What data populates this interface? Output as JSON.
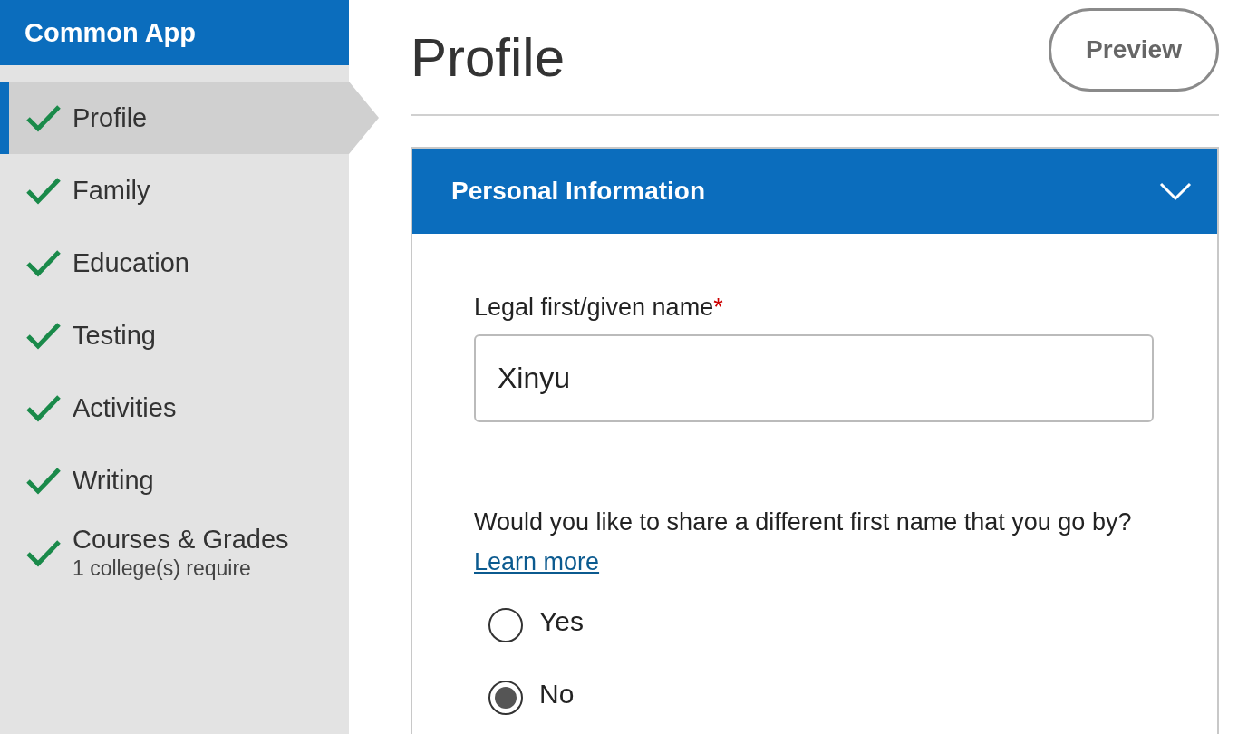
{
  "app_title": "Common App",
  "sidebar": {
    "items": [
      {
        "label": "Profile",
        "complete": true,
        "selected": true
      },
      {
        "label": "Family",
        "complete": true,
        "selected": false
      },
      {
        "label": "Education",
        "complete": true,
        "selected": false
      },
      {
        "label": "Testing",
        "complete": true,
        "selected": false
      },
      {
        "label": "Activities",
        "complete": true,
        "selected": false
      },
      {
        "label": "Writing",
        "complete": true,
        "selected": false
      },
      {
        "label": "Courses & Grades",
        "sublabel": "1 college(s) require",
        "complete": true,
        "selected": false
      }
    ]
  },
  "page_title": "Profile",
  "preview_button": "Preview",
  "section": {
    "title": "Personal Information",
    "expanded": true,
    "first_name": {
      "label": "Legal first/given name",
      "required_mark": "*",
      "value": "Xinyu"
    },
    "question": {
      "text": "Would you like to share a different first name that you go by?",
      "link": "Learn more",
      "options": [
        {
          "label": "Yes",
          "selected": false
        },
        {
          "label": "No",
          "selected": true
        }
      ]
    }
  }
}
